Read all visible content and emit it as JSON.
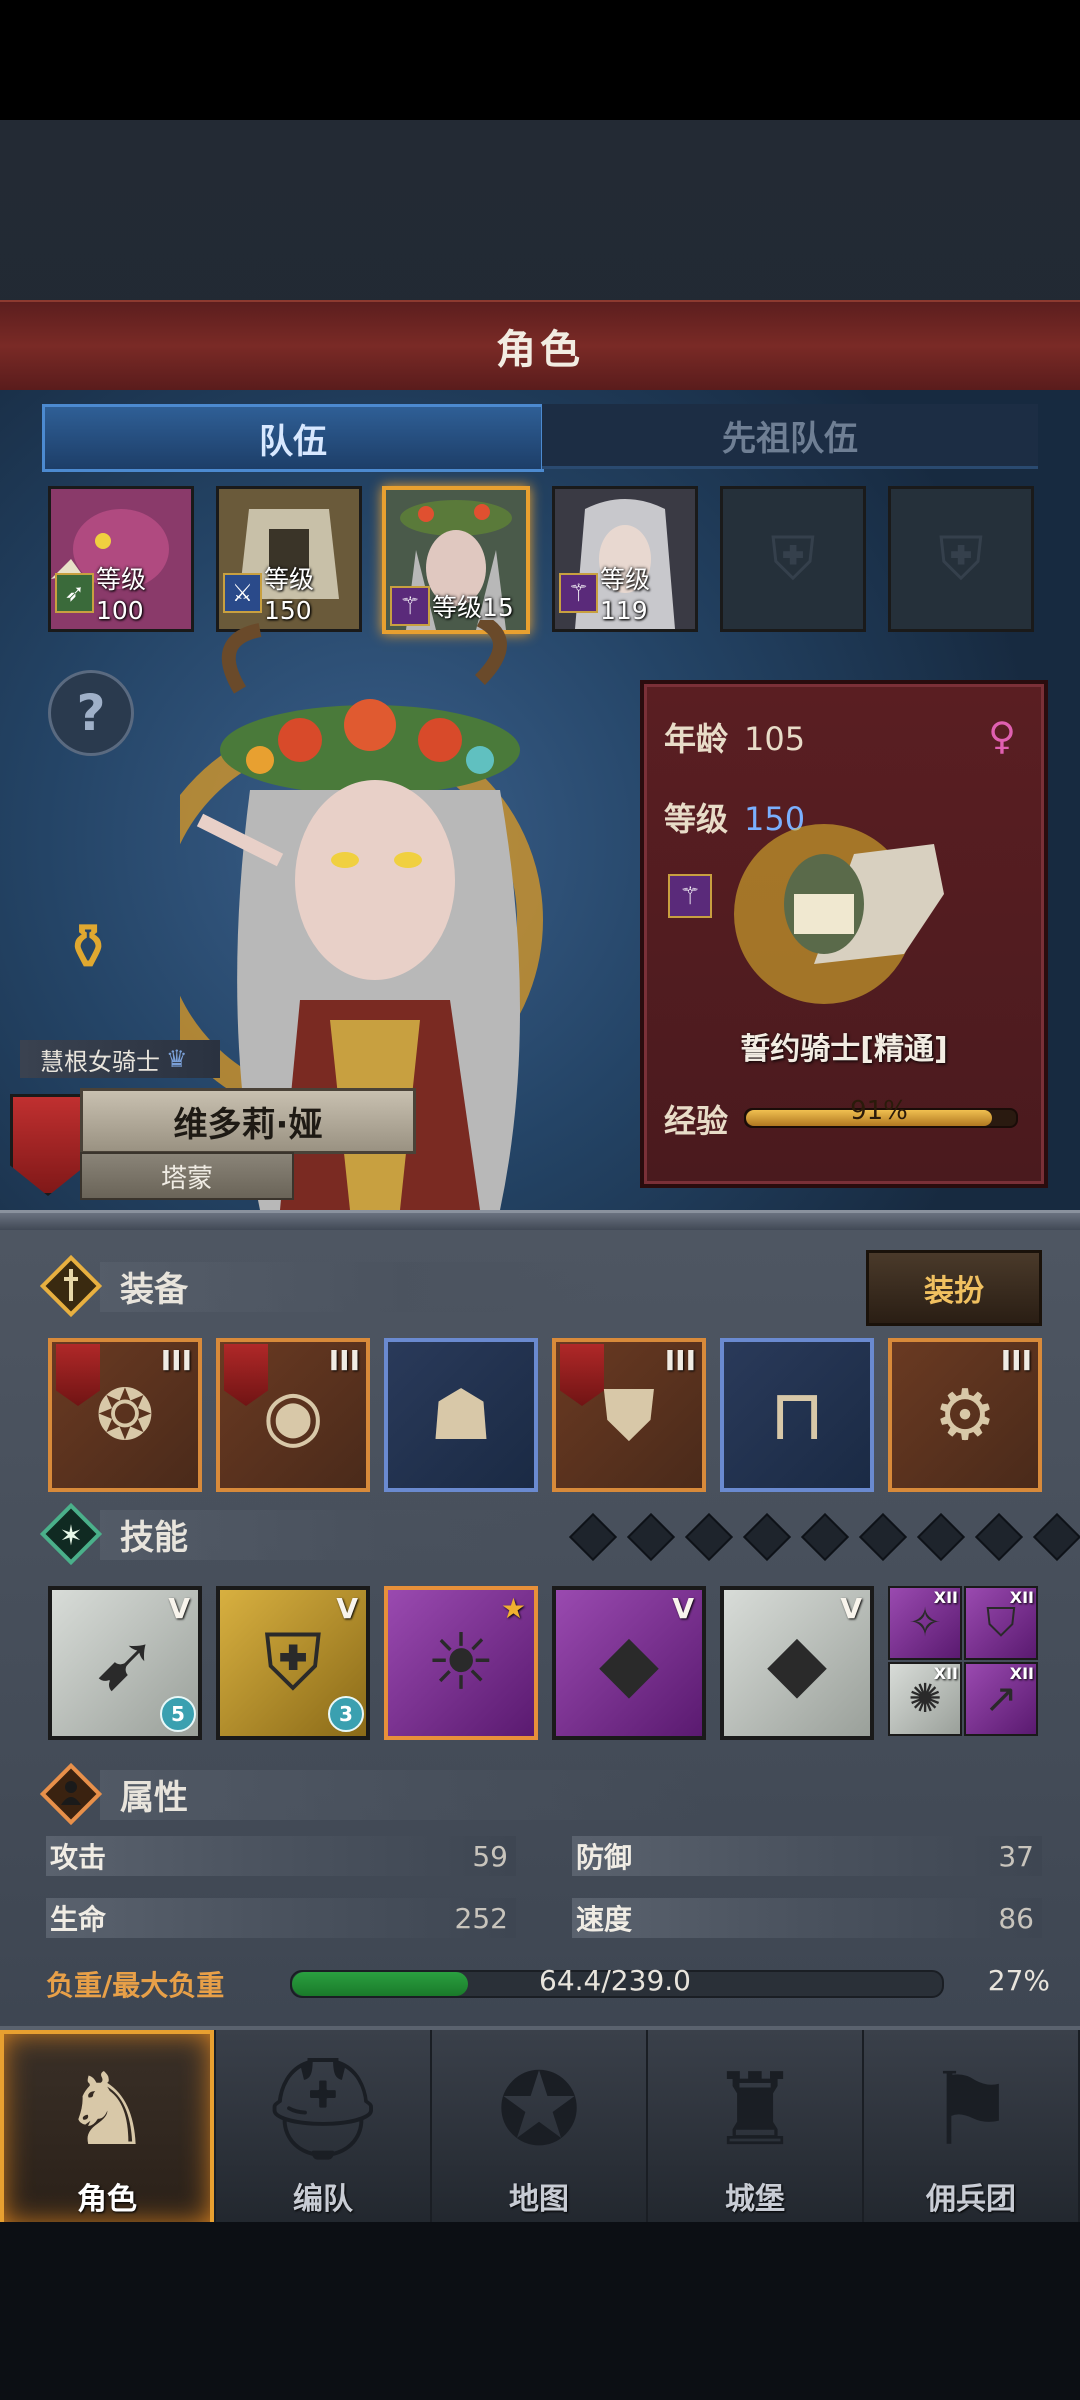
{
  "header": {
    "title": "角色"
  },
  "tabs": [
    {
      "label": "队伍",
      "active": true
    },
    {
      "label": "先祖队伍",
      "active": false
    }
  ],
  "party": [
    {
      "level_label": "等级100",
      "weapon": "bow-icon",
      "selected": false
    },
    {
      "level_label": "等级150",
      "weapon": "sword-icon",
      "selected": false
    },
    {
      "level_label": "等级15",
      "weapon": "staff-icon",
      "selected": true
    },
    {
      "level_label": "等级119",
      "weapon": "staff-icon",
      "selected": false
    },
    {
      "empty": true
    },
    {
      "empty": true
    }
  ],
  "hero": {
    "class": "慧根女骑士",
    "name": "维多莉·娅",
    "origin": "塔蒙"
  },
  "info": {
    "age_label": "年龄",
    "age": "105",
    "level_label": "等级",
    "level": "150",
    "mount_name": "誓约骑士[精通]",
    "exp_label": "经验",
    "exp_text": "91%",
    "exp_fraction": 0.91
  },
  "equipment": {
    "label": "装备",
    "outfit_button": "装扮",
    "items": [
      {
        "tier": "III",
        "rarity": "orange",
        "banner": true
      },
      {
        "tier": "III",
        "rarity": "orange",
        "banner": true
      },
      {
        "tier": "",
        "rarity": "blue",
        "banner": false
      },
      {
        "tier": "III",
        "rarity": "orange",
        "banner": true
      },
      {
        "tier": "",
        "rarity": "blue",
        "banner": false
      },
      {
        "tier": "III",
        "rarity": "orange",
        "banner": false
      }
    ]
  },
  "skills": {
    "label": "技能",
    "slots": [
      {
        "tier": "V",
        "color": "grey",
        "count": "5"
      },
      {
        "tier": "V",
        "color": "gold",
        "count": "3"
      },
      {
        "tier": "",
        "color": "purple",
        "count": ""
      },
      {
        "tier": "V",
        "color": "purple",
        "count": ""
      },
      {
        "tier": "V",
        "color": "grey",
        "count": ""
      }
    ],
    "mini": [
      {
        "tier": "XII",
        "color": "purple"
      },
      {
        "tier": "XII",
        "color": "purple"
      },
      {
        "tier": "XII",
        "color": "grey"
      },
      {
        "tier": "XII",
        "color": "purple"
      }
    ]
  },
  "attributes": {
    "label": "属性",
    "attack_label": "攻击",
    "attack": "59",
    "defense_label": "防御",
    "defense": "37",
    "hp_label": "生命",
    "hp": "252",
    "speed_label": "速度",
    "speed": "86",
    "load_label": "负重/最大负重",
    "load_text": "64.4/239.0",
    "load_pct": "27%",
    "load_fraction": 0.27
  },
  "nav": [
    {
      "label": "角色",
      "icon": "knight-icon",
      "active": true
    },
    {
      "label": "编队",
      "icon": "helmet-icon",
      "active": false
    },
    {
      "label": "地图",
      "icon": "compass-icon",
      "active": false
    },
    {
      "label": "城堡",
      "icon": "castle-icon",
      "active": false
    },
    {
      "label": "佣兵团",
      "icon": "banner-icon",
      "active": false
    }
  ]
}
